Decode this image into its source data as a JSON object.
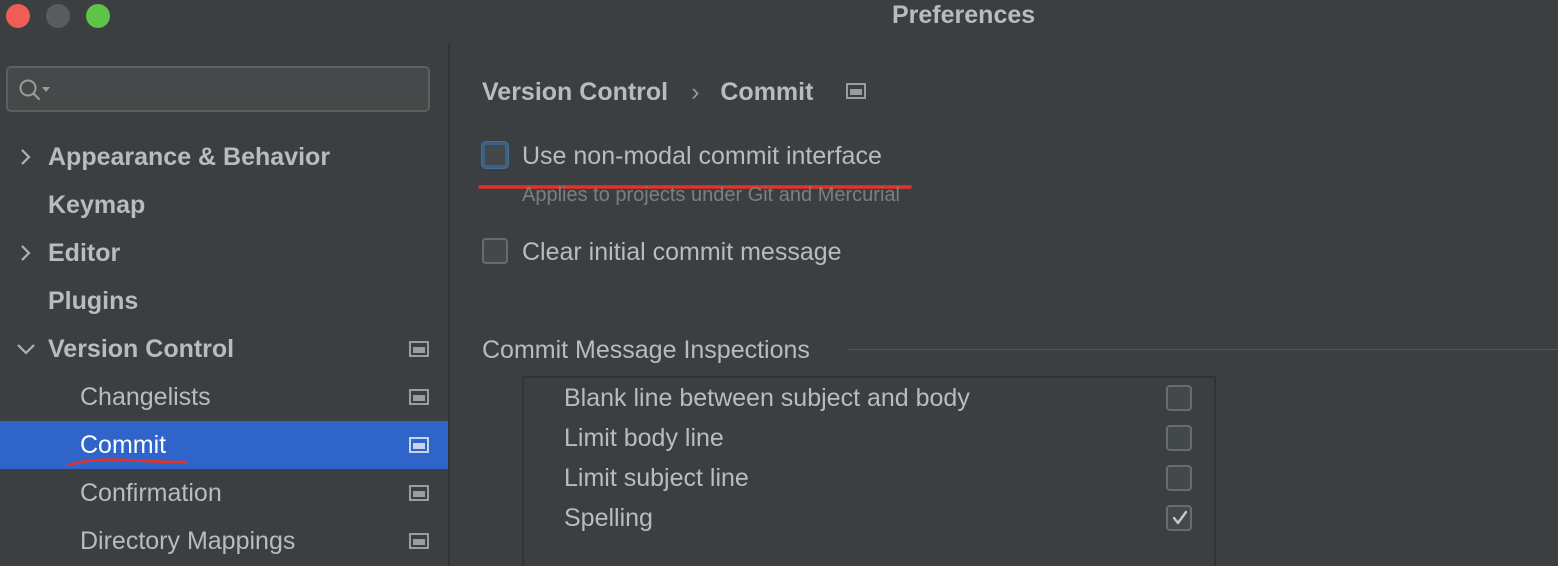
{
  "window": {
    "title": "Preferences",
    "traffic_lights": {
      "close": "#ee5d56",
      "minimize": "#5a5d60",
      "maximize": "#5ec448"
    }
  },
  "search": {
    "value": "",
    "icon": "search-icon"
  },
  "sidebar": {
    "items": [
      {
        "label": "Appearance & Behavior",
        "level": 0,
        "expandable": true,
        "expanded": false,
        "project_icon": false,
        "selected": false
      },
      {
        "label": "Keymap",
        "level": 0,
        "expandable": false,
        "project_icon": false,
        "selected": false
      },
      {
        "label": "Editor",
        "level": 0,
        "expandable": true,
        "expanded": false,
        "project_icon": false,
        "selected": false
      },
      {
        "label": "Plugins",
        "level": 0,
        "expandable": false,
        "project_icon": false,
        "selected": false
      },
      {
        "label": "Version Control",
        "level": 0,
        "expandable": true,
        "expanded": true,
        "project_icon": true,
        "selected": false
      },
      {
        "label": "Changelists",
        "level": 1,
        "project_icon": true,
        "selected": false
      },
      {
        "label": "Commit",
        "level": 1,
        "project_icon": true,
        "selected": true
      },
      {
        "label": "Confirmation",
        "level": 1,
        "project_icon": true,
        "selected": false
      },
      {
        "label": "Directory Mappings",
        "level": 1,
        "project_icon": true,
        "selected": false
      }
    ],
    "selection_color": "#2f65ca"
  },
  "main": {
    "breadcrumb": {
      "parent": "Version Control",
      "separator": "›",
      "current": "Commit"
    },
    "options": [
      {
        "label": "Use non-modal commit interface",
        "checked": false,
        "focused": true
      },
      {
        "label": "Clear initial commit message",
        "checked": false,
        "focused": false
      }
    ],
    "option_hint": "Applies to projects under Git and Mercurial",
    "inspections": {
      "title": "Commit Message Inspections",
      "items": [
        {
          "label": "Blank line between subject and body",
          "checked": false
        },
        {
          "label": "Limit body line",
          "checked": false
        },
        {
          "label": "Limit subject line",
          "checked": false
        },
        {
          "label": "Spelling",
          "checked": true
        }
      ]
    }
  },
  "annotation_color": "#e2322b"
}
